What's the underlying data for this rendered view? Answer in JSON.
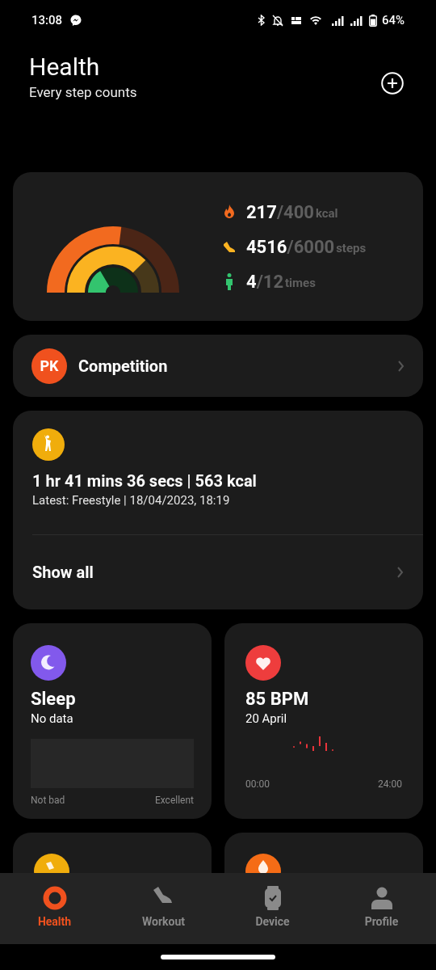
{
  "status_bar": {
    "time": "13:08",
    "battery": "64%"
  },
  "header": {
    "title": "Health",
    "subtitle": "Every step counts"
  },
  "activity": {
    "stats": [
      {
        "kind": "calories",
        "value": "217",
        "goal": "/400",
        "unit": "kcal"
      },
      {
        "kind": "steps",
        "value": "4516",
        "goal": "/6000",
        "unit": "steps"
      },
      {
        "kind": "stand",
        "value": "4",
        "goal": "/12",
        "unit": "times"
      }
    ]
  },
  "competition": {
    "badge": "PK",
    "label": "Competition"
  },
  "workout": {
    "summary": "1 hr 41 mins 36 secs | 563 kcal",
    "latest": "Latest: Freestyle | 18/04/2023, 18:19",
    "link": "Show all"
  },
  "sleep": {
    "title": "Sleep",
    "subtitle": "No data",
    "scale_min": "Not bad",
    "scale_max": "Excellent"
  },
  "heart_rate": {
    "title": "85 BPM",
    "subtitle": "20 April",
    "axis_start": "00:00",
    "axis_end": "24:00"
  },
  "nav": [
    {
      "kind": "health",
      "label": "Health",
      "selected": true
    },
    {
      "kind": "workout",
      "label": "Workout",
      "selected": false
    },
    {
      "kind": "device",
      "label": "Device",
      "selected": false
    },
    {
      "kind": "profile",
      "label": "Profile",
      "selected": false
    }
  ]
}
